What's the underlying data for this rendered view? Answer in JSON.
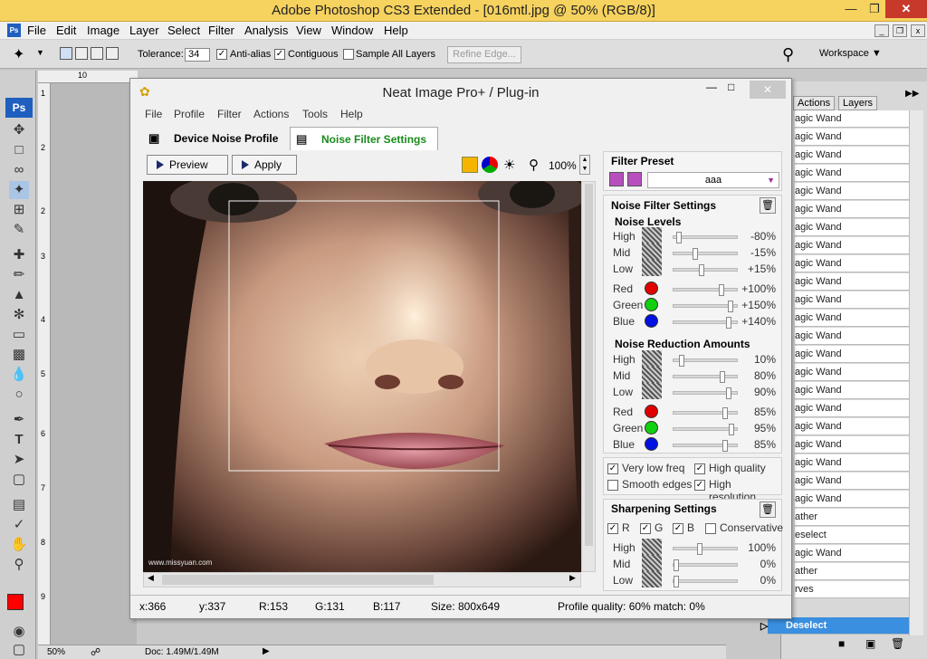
{
  "window": {
    "title": "Adobe Photoshop CS3 Extended - [016mtl.jpg @ 50% (RGB/8)]"
  },
  "menu": [
    "File",
    "Edit",
    "Image",
    "Layer",
    "Select",
    "Filter",
    "Analysis",
    "View",
    "Window",
    "Help"
  ],
  "options": {
    "tolerance_label": "Tolerance:",
    "tolerance": "34",
    "antialias": "Anti-alias",
    "contiguous": "Contiguous",
    "sample_all": "Sample All Layers",
    "refine": "Refine Edge...",
    "workspace": "Workspace"
  },
  "ruler": {
    "h": [
      "10"
    ],
    "v": [
      "1",
      "2",
      "2",
      "3",
      "4",
      "5",
      "6",
      "7",
      "8",
      "9"
    ]
  },
  "status": {
    "zoom": "50%",
    "doc": "Doc: 1.49M/1.49M"
  },
  "panel": {
    "tabs": [
      "Actions",
      "Layers"
    ],
    "items": [
      "agic Wand",
      "agic Wand",
      "agic Wand",
      "agic Wand",
      "agic Wand",
      "agic Wand",
      "agic Wand",
      "agic Wand",
      "agic Wand",
      "agic Wand",
      "agic Wand",
      "agic Wand",
      "agic Wand",
      "agic Wand",
      "agic Wand",
      "agic Wand",
      "agic Wand",
      "agic Wand",
      "agic Wand",
      "agic Wand",
      "agic Wand",
      "agic Wand",
      "ather",
      "eselect",
      "agic Wand",
      "ather",
      "rves"
    ],
    "selected": "Deselect"
  },
  "neat": {
    "title": "Neat Image Pro+ / Plug-in",
    "menu": [
      "File",
      "Profile",
      "Filter",
      "Actions",
      "Tools",
      "Help"
    ],
    "tabs": [
      "Device Noise Profile",
      "Noise Filter Settings"
    ],
    "preview": "Preview",
    "apply": "Apply",
    "zoom": "100%",
    "watermark": "www.missyuan.com",
    "statusbar": {
      "x": "x:366",
      "y": "y:337",
      "r": "R:153",
      "g": "G:131",
      "b": "B:117",
      "size": "Size: 800x649",
      "quality": "Profile quality: 60%  match: 0%"
    },
    "filter_preset": {
      "label": "Filter Preset",
      "value": "aaa"
    },
    "noise_filter": {
      "label": "Noise Filter Settings",
      "levels_label": "Noise Levels",
      "levels": [
        {
          "name": "High",
          "value": "-80%",
          "pos": 0.05
        },
        {
          "name": "Mid",
          "value": "-15%",
          "pos": 0.33
        },
        {
          "name": "Low",
          "value": "+15%",
          "pos": 0.43
        },
        {
          "name": "Red",
          "value": "+100%",
          "pos": 0.78,
          "color": "#e00000"
        },
        {
          "name": "Green",
          "value": "+150%",
          "pos": 0.94,
          "color": "#10d010"
        },
        {
          "name": "Blue",
          "value": "+140%",
          "pos": 0.91,
          "color": "#0010e0"
        }
      ],
      "reduction_label": "Noise Reduction Amounts",
      "reduction": [
        {
          "name": "High",
          "value": "10%",
          "pos": 0.1
        },
        {
          "name": "Mid",
          "value": "80%",
          "pos": 0.8
        },
        {
          "name": "Low",
          "value": "90%",
          "pos": 0.9
        },
        {
          "name": "Red",
          "value": "85%",
          "pos": 0.85,
          "color": "#e00000"
        },
        {
          "name": "Green",
          "value": "95%",
          "pos": 0.95,
          "color": "#10d010"
        },
        {
          "name": "Blue",
          "value": "85%",
          "pos": 0.85,
          "color": "#0010e0"
        }
      ],
      "checks": [
        {
          "label": "Very low freq",
          "on": true
        },
        {
          "label": "High quality",
          "on": true
        },
        {
          "label": "Smooth edges",
          "on": false
        },
        {
          "label": "High resolution",
          "on": true
        }
      ]
    },
    "sharpening": {
      "label": "Sharpening Settings",
      "channels": [
        {
          "label": "R",
          "on": true
        },
        {
          "label": "G",
          "on": true
        },
        {
          "label": "B",
          "on": true
        },
        {
          "label": "Conservative",
          "on": false
        }
      ],
      "rows": [
        {
          "name": "High",
          "value": "100%",
          "pos": 0.4
        },
        {
          "name": "Mid",
          "value": "0%",
          "pos": 0.0
        },
        {
          "name": "Low",
          "value": "0%",
          "pos": 0.0
        }
      ]
    }
  }
}
